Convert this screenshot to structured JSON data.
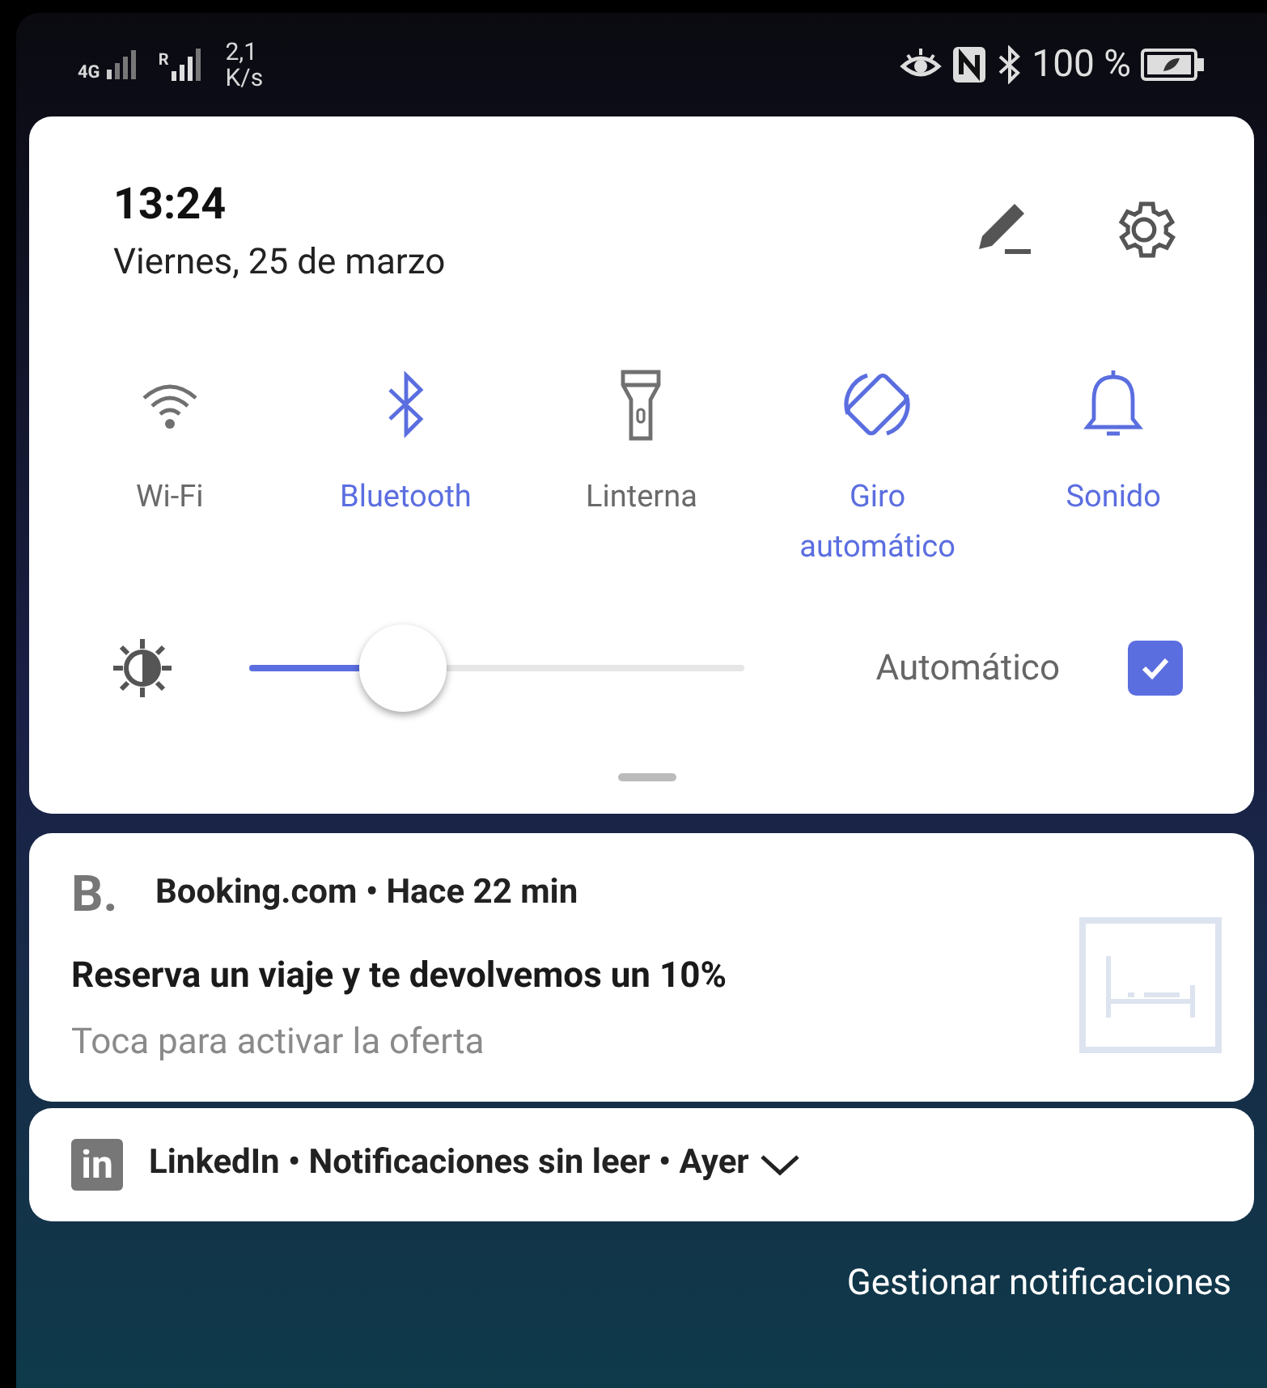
{
  "status_bar": {
    "network_1": "4G",
    "network_2": "R",
    "speed": "2,1",
    "speed_unit": "K/s",
    "battery": "100 %"
  },
  "quick_settings": {
    "time": "13:24",
    "date": "Viernes, 25 de marzo",
    "tiles": [
      {
        "kind": "wifi",
        "label": "Wi-Fi",
        "on": false
      },
      {
        "kind": "bluetooth",
        "label": "Bluetooth",
        "on": true
      },
      {
        "kind": "flashlight",
        "label": "Linterna",
        "on": false
      },
      {
        "kind": "rotate",
        "label": "Giro automático",
        "on": true
      },
      {
        "kind": "sound",
        "label": "Sonido",
        "on": true
      }
    ],
    "brightness": {
      "level": 0.31,
      "auto_label": "Automático",
      "auto_checked": true
    }
  },
  "notifications": [
    {
      "kind": "expanded",
      "icon_text": "B.",
      "header": "Booking.com • Hace 22 min",
      "title": "Reserva un viaje y te devolvemos un 10%",
      "text": "Toca para activar la oferta"
    },
    {
      "kind": "collapsed",
      "icon_text": "in",
      "header": "LinkedIn • Notificaciones sin leer • Ayer"
    }
  ],
  "manage_label": "Gestionar notificaciones"
}
